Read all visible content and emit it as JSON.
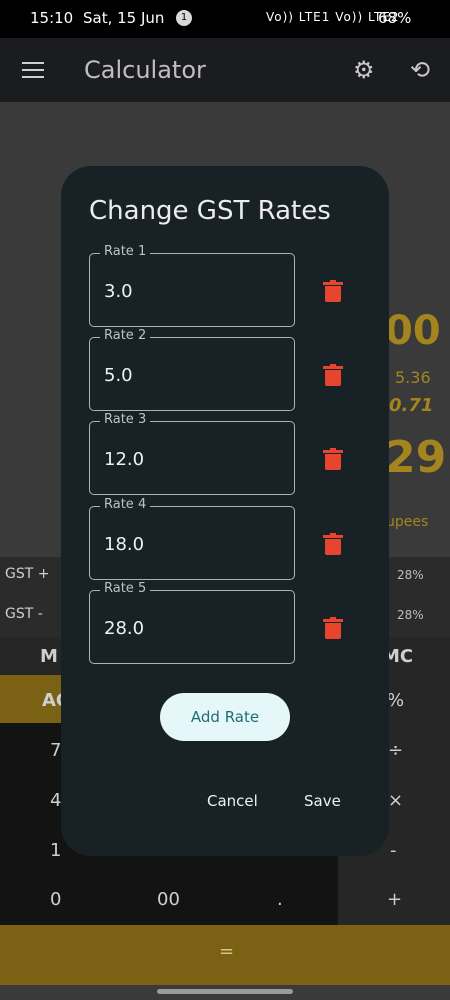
{
  "status_bar": {
    "time": "15:10",
    "date": "Sat, 15 Jun",
    "notification_count": "1",
    "network": "Vo)) LTE1 Vo)) LTE2",
    "battery": "68%"
  },
  "app_bar": {
    "title": "Calculator",
    "menu_icon": "hamburger-menu-icon",
    "settings_icon": "gear-icon",
    "history_icon": "history-icon"
  },
  "background": {
    "display_line1": "00",
    "display_line2": "5.36",
    "display_line3": "0.71",
    "display_line4": "29",
    "display_line5": "upees",
    "gst_plus_label": "GST +",
    "gst_minus_label": "GST -",
    "gst_plus_rate": "28%",
    "gst_minus_rate": "28%",
    "memory_left": "M",
    "memory_right": "MC",
    "ac_label": "AC",
    "percent": "%",
    "seven": "7",
    "divide": "÷",
    "four": "4",
    "multiply": "×",
    "one": "1",
    "minus": "-",
    "zero": "0",
    "double_zero": "00",
    "dot": ".",
    "plus": "+",
    "equals": "="
  },
  "dialog": {
    "title": "Change GST Rates",
    "rates": [
      {
        "label": "Rate 1",
        "value": "3.0"
      },
      {
        "label": "Rate 2",
        "value": "5.0"
      },
      {
        "label": "Rate 3",
        "value": "12.0"
      },
      {
        "label": "Rate 4",
        "value": "18.0"
      },
      {
        "label": "Rate 5",
        "value": "28.0"
      }
    ],
    "delete_icon": "trash-icon",
    "add_button": "Add Rate",
    "cancel_button": "Cancel",
    "save_button": "Save",
    "colors": {
      "dialog_bg": "#182226",
      "delete": "#e8452f",
      "add_button_bg": "#e6f7f9",
      "add_button_text": "#1d6f73"
    }
  }
}
